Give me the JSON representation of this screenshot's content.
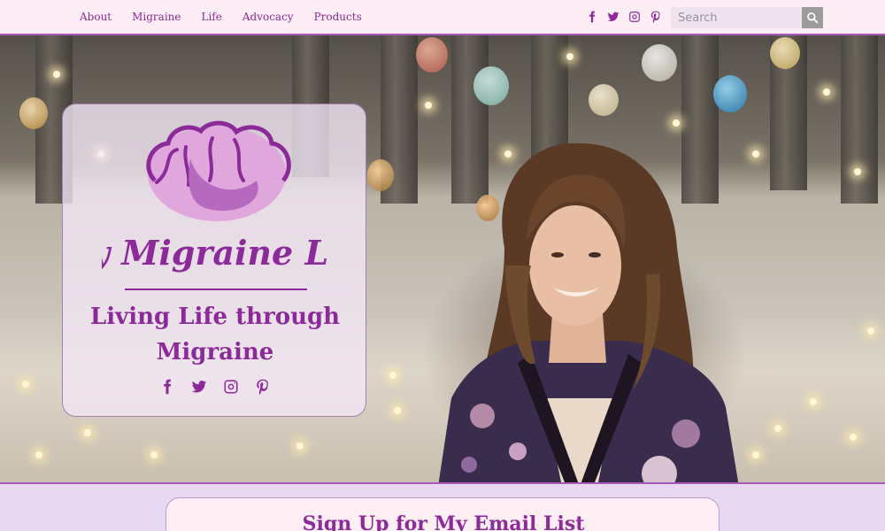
{
  "nav": {
    "items": [
      {
        "label": "About"
      },
      {
        "label": "Migraine"
      },
      {
        "label": "Life"
      },
      {
        "label": "Advocacy"
      },
      {
        "label": "Products"
      }
    ]
  },
  "social_icons": [
    "facebook-icon",
    "twitter-icon",
    "instagram-icon",
    "pinterest-icon"
  ],
  "search": {
    "placeholder": "Search",
    "button_icon": "search-icon"
  },
  "hero": {
    "logo_text": "My Migraine Life",
    "tagline": "Living Life through Migraine"
  },
  "signup": {
    "heading": "Sign Up for My Email List"
  },
  "colors": {
    "brand_purple": "#8c2a9a",
    "nav_background": "#fdeef6",
    "page_background": "#e8d9f3"
  }
}
